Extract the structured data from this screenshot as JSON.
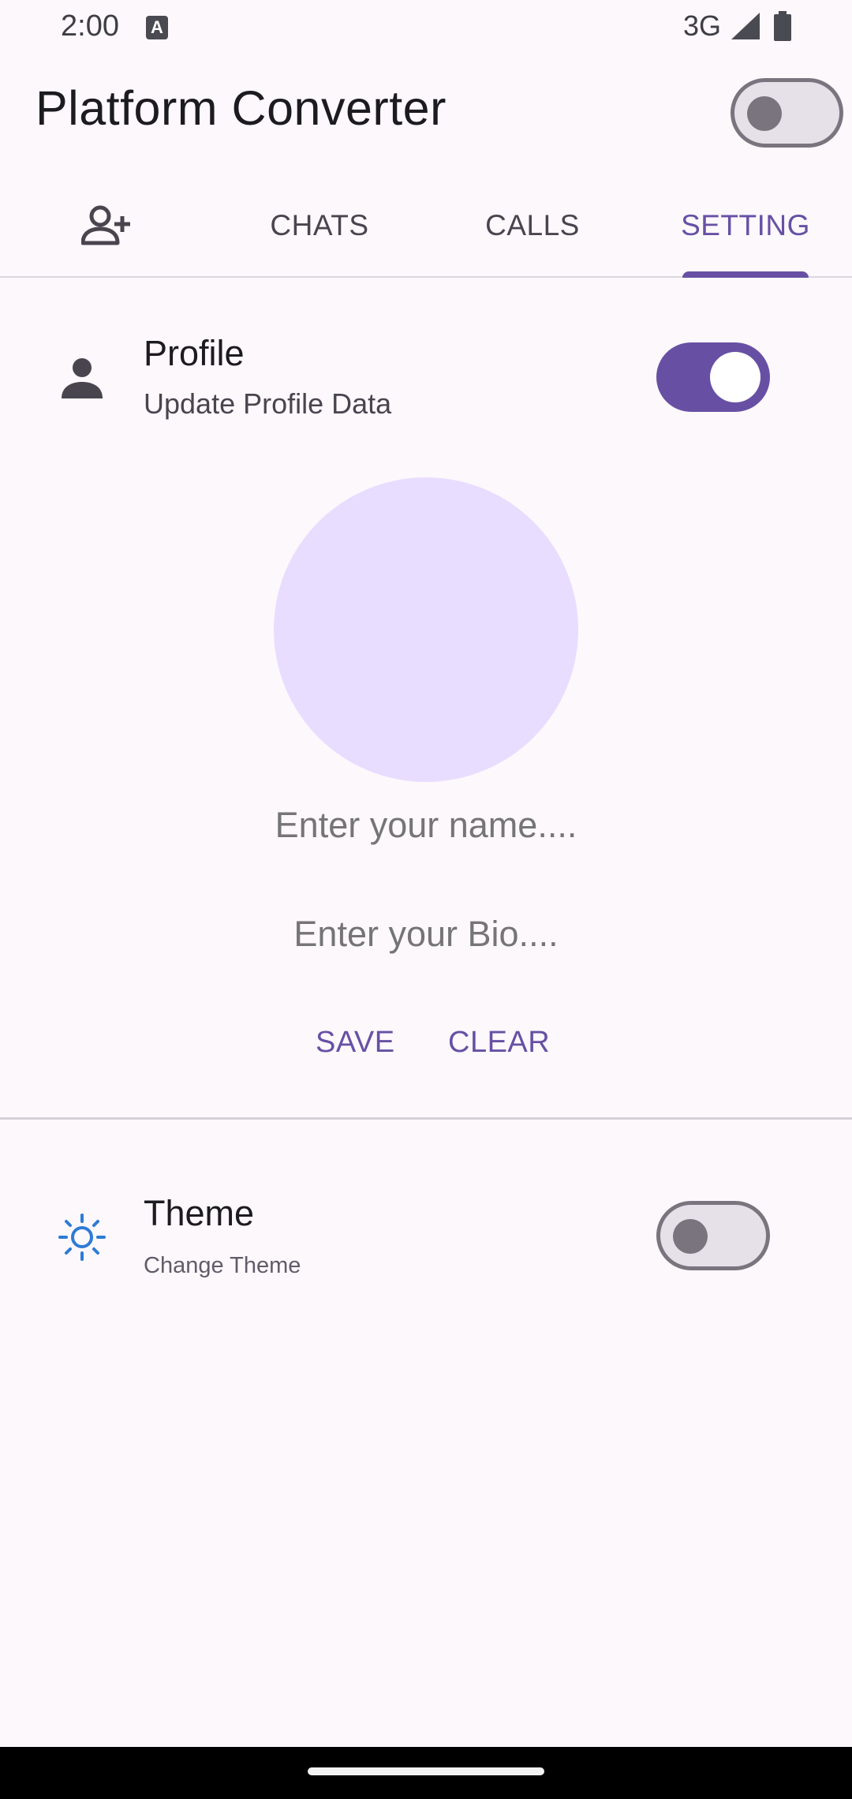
{
  "status_bar": {
    "time": "2:00",
    "a_icon": "A",
    "network": "3G",
    "icons": [
      "signal-icon",
      "battery-icon"
    ]
  },
  "app_bar": {
    "title": "Platform Converter",
    "platform_switch_on": false
  },
  "tabs": {
    "items": [
      {
        "icon": "person-add-icon",
        "label": ""
      },
      {
        "label": "CHATS"
      },
      {
        "label": "CALLS"
      },
      {
        "label": "SETTING"
      }
    ],
    "selected": "SETTING",
    "accent_color": "#6750a4"
  },
  "profile": {
    "icon": "person-icon",
    "title": "Profile",
    "subtitle": "Update Profile Data",
    "toggle_on": true
  },
  "profile_form": {
    "name_placeholder": "Enter your name....",
    "bio_placeholder": "Enter your Bio....",
    "save_label": "SAVE",
    "clear_label": "CLEAR",
    "avatar_color": "#e9ddff"
  },
  "theme": {
    "icon": "sun-icon",
    "title": "Theme",
    "subtitle": "Change Theme",
    "toggle_on": false
  }
}
